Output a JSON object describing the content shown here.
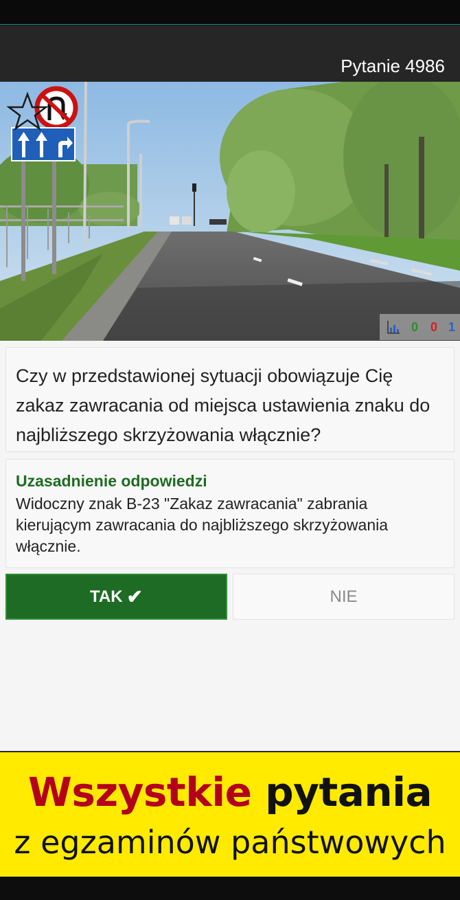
{
  "app_bar": {
    "title": "Pytanie 4986"
  },
  "stats": {
    "correct": "0",
    "wrong": "0",
    "total": "1",
    "icon": "bar-chart-icon"
  },
  "question": {
    "text": "Czy w przedstawionej sytuacji obowiązuje Cię zakaz zawracania od miejsca ustawienia znaku do najbliższego skrzyżowania włącznie?"
  },
  "explanation": {
    "title": "Uzasadnienie odpowiedzi",
    "text": "Widoczny znak B-23 \"Zakaz zawracania\" zabrania kierującym zawracania do najbliższego skrzyżowania włącznie."
  },
  "answers": {
    "yes_label": "TAK",
    "yes_check": "✔",
    "no_label": "NIE"
  },
  "banner": {
    "highlight": "Wszystkie",
    "rest": "pytania",
    "line2": "z egzaminów państwowych"
  },
  "colors": {
    "accent_green": "#1e6b25",
    "banner_yellow": "#ffea00",
    "banner_red": "#b3001b"
  }
}
